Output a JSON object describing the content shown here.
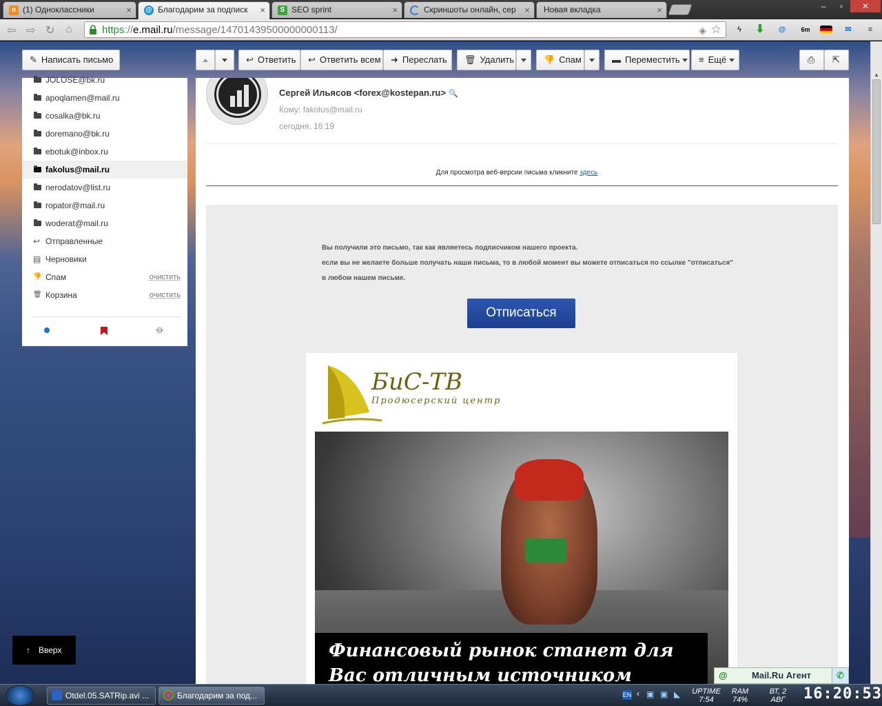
{
  "browser": {
    "tabs": [
      {
        "label": "(1) Одноклассники",
        "favicon": "odnoklassniki-icon",
        "color": "#f28c1e"
      },
      {
        "label": "Благодарим за подписк",
        "favicon": "mailru-icon",
        "color": "#168de2"
      },
      {
        "label": "SEO sprint",
        "favicon": "seosprint-icon",
        "color": "#3aa63a"
      },
      {
        "label": "Скриншоты онлайн, сер",
        "favicon": "loading-icon",
        "color": "#3b7bd4"
      },
      {
        "label": "Новая вкладка",
        "favicon": "",
        "color": ""
      }
    ],
    "url": {
      "scheme": "https",
      "sep": "://",
      "host": "e.mail.ru",
      "path": "/message/14701439500000000113/"
    }
  },
  "mail_toolbar": {
    "compose": "Написать письмо",
    "reply": "Ответить",
    "reply_all": "Ответить всем",
    "forward": "Переслать",
    "delete": "Удалить",
    "spam": "Спам",
    "move": "Переместить",
    "more": "Ещё"
  },
  "sidebar": {
    "folders": [
      {
        "label": "JOLOSE@bk.ru"
      },
      {
        "label": "apoqlamen@mail.ru"
      },
      {
        "label": "cosalka@bk.ru"
      },
      {
        "label": "doremano@bk.ru"
      },
      {
        "label": "ebotuk@inbox.ru"
      },
      {
        "label": "fakolus@mail.ru"
      },
      {
        "label": "nerodatov@list.ru"
      },
      {
        "label": "ropator@mail.ru"
      },
      {
        "label": "woderat@mail.ru"
      }
    ],
    "sent": "Отправленные",
    "drafts": "Черновики",
    "spam": "Спам",
    "trash": "Корзина",
    "clear": "очистить"
  },
  "up_button": "Вверх",
  "message": {
    "sender": "Сергей Ильясов <forex@kostepan.ru>",
    "to": "Кому: fakolus@mail.ru",
    "date": "сегодня, 16:19",
    "web_version_text": "Для просмотра веб-версии письма кликните",
    "web_version_link": "здесь",
    "notice_line1": "Вы получили это письмо, так как являетесь подписчиком нашего проекта.",
    "notice_line2": "если вы не желаете больше получать наши письма, то в любой момент вы можете отписаться по ссылке \"отписаться\" в любом нашем письме.",
    "unsubscribe": "Отписаться",
    "brand_name": "БиС-ТВ",
    "brand_sub": "Продюсерский центр",
    "tagline": "Финансовый рынок станет для Вас отличным источником прибыли!"
  },
  "agent": {
    "label": "Mail.Ru Агент"
  },
  "taskbar": {
    "tasks": [
      {
        "label": "Otdel.05.SATRip.avi ..."
      },
      {
        "label": "Благодарим за под..."
      }
    ],
    "lang": "EN",
    "uptime_label": "UPTIME",
    "uptime_value": "7:54",
    "ram_label": "RAM",
    "ram_value": "74%",
    "day": "ВТ, 2",
    "month": "АВГ",
    "clock": "16:20:53"
  }
}
